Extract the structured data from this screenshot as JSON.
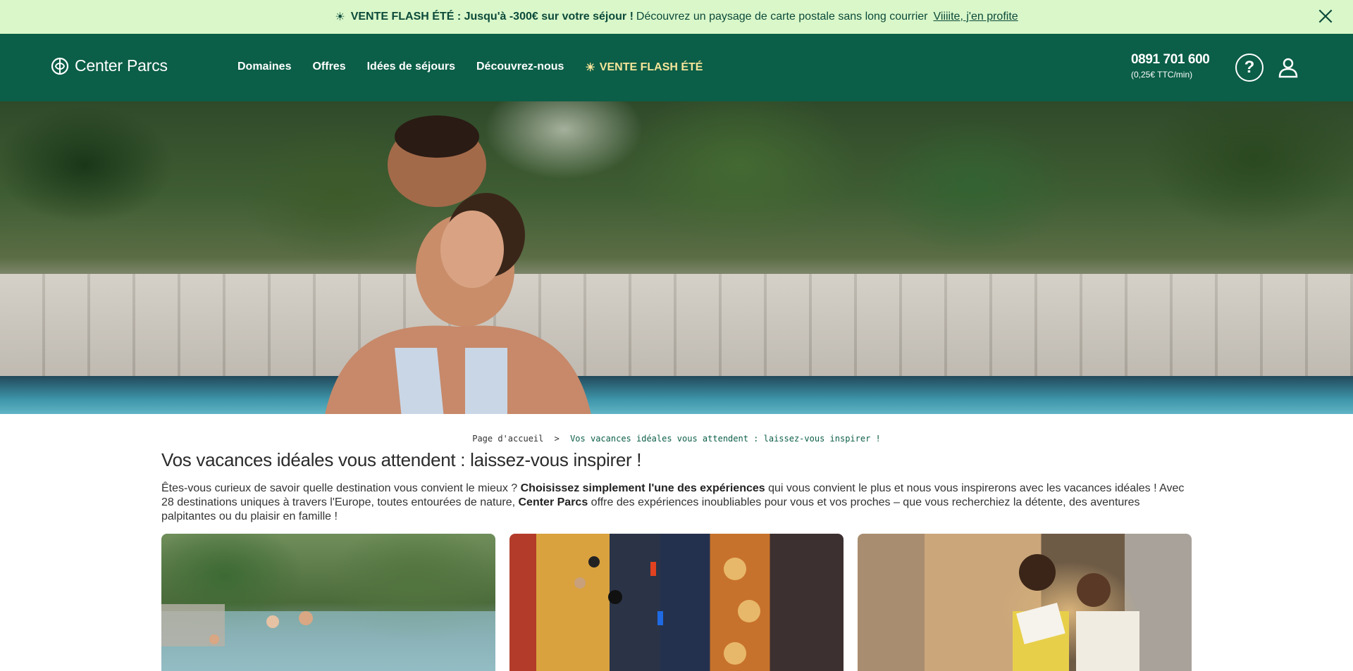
{
  "promo": {
    "headline": "VENTE FLASH ÉTÉ : Jusqu'à -300€ sur votre séjour !",
    "description": "Découvrez un paysage de carte postale sans long courrier",
    "link": "Viiiite, j'en profite"
  },
  "header": {
    "brand": "Center Parcs",
    "nav": [
      "Domaines",
      "Offres",
      "Idées de séjours",
      "Découvrez-nous"
    ],
    "flash_item": "VENTE FLASH ÉTÉ",
    "phone_number": "0891 701 600",
    "phone_price": "(0,25€ TTC/min)",
    "help_symbol": "?"
  },
  "breadcrumb": {
    "home": "Page d'accueil",
    "separator": ">",
    "current": "Vos vacances idéales vous attendent : laissez-vous inspirer !"
  },
  "page": {
    "title": "Vos vacances idéales vous attendent : laissez-vous inspirer !",
    "intro_part1": "Êtes-vous curieux de savoir quelle destination vous convient le mieux ? ",
    "intro_bold1": "Choisissez simplement l'une des expériences",
    "intro_part2": " qui vous convient le plus et nous vous inspirerons avec les vacances idéales ! Avec 28 destinations uniques à travers l'Europe, toutes entourées de nature, ",
    "intro_bold2": "Center Parcs",
    "intro_part3": " offre des expériences inoubliables pour vous et vos proches – que vous recherchiez la détente, des aventures palpitantes ou du plaisir en famille !"
  },
  "cards": [
    {
      "image": "tropical-pool-family"
    },
    {
      "image": "climbing-wall"
    },
    {
      "image": "couple-reading-sofa"
    }
  ],
  "icons": {
    "promo": "sun-icon",
    "close": "close-icon",
    "logo": "center-parcs-logo-icon",
    "help": "help-icon",
    "user": "user-icon"
  },
  "colors": {
    "promo_bg": "#d9f7c9",
    "header_bg": "#0b5e47",
    "flash_accent": "#f6e59a",
    "breadcrumb_current": "#0b5e47"
  }
}
